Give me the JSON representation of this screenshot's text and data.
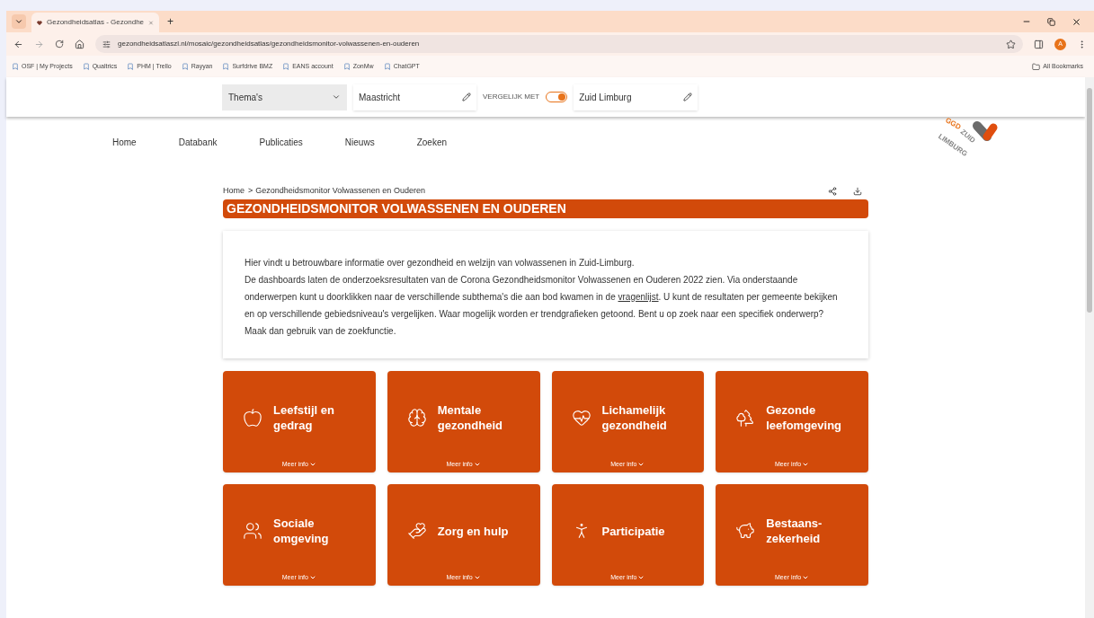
{
  "browser": {
    "tab": {
      "title": "Gezondheidsatlas - Gezondhe",
      "selected": true
    },
    "new_tab": "+",
    "url": "gezondheidsatlaszl.nl/mosaic/gezondheidsatlas/gezondheidsmonitor-volwassenen-en-ouderen",
    "profile_initial": "A",
    "bookmarks": [
      "OSF | My Projects",
      "Qualtrics",
      "PHM | Trello",
      "Rayyan",
      "Surfdrive BMZ",
      "EANS account",
      "ZonMw",
      "ChatGPT"
    ],
    "all_bookmarks": "All Bookmarks"
  },
  "filter_bar": {
    "theme_select": "Thema's",
    "region": "Maastricht",
    "compare_label": "VERGELIJK MET",
    "compare_on": true,
    "compare_region": "Zuid Limburg"
  },
  "nav": [
    {
      "label": "Home"
    },
    {
      "label": "Databank"
    },
    {
      "label": "Publicaties"
    },
    {
      "label": "Nieuws"
    },
    {
      "label": "Zoeken"
    }
  ],
  "logo": {
    "top": "GGD",
    "middle": "ZUID",
    "bottom": "LIMBURG"
  },
  "breadcrumb": [
    "Home",
    "Gezondheidsmonitor Volwassenen en Ouderen"
  ],
  "breadcrumb_separator": ">",
  "page_title": "GEZONDHEIDSMONITOR VOLWASSENEN EN OUDEREN",
  "intro": {
    "line_1": "Hier vindt u betrouwbare informatie over gezondheid en welzijn van volwassenen in Zuid-Limburg.",
    "before_link": "De dashboards laten de onderzoeksresultaten van de Corona Gezondheidsmonitor Volwassenen en Ouderen 2022 zien. Via onderstaande onderwerpen kunt u doorklikken naar de verschillende subthema's die aan bod kwamen in de",
    "link": "vragenlijst",
    "after_link": ". U kunt de resultaten per gemeente bekijken en op verschillende gebiedsniveau's vergelijken. Waar mogelijk worden er trendgrafieken getoond. Bent u op zoek naar een specifiek onderwerp? Maak dan gebruik van de zoekfunctie."
  },
  "tiles": [
    {
      "title": "Leefstijl en gedrag",
      "more": "Meer info"
    },
    {
      "title": "Mentale gezondheid",
      "more": "Meer info"
    },
    {
      "title": "Lichamelijk gezondheid",
      "more": "Meer info"
    },
    {
      "title": "Gezonde leefomgeving",
      "more": "Meer info"
    },
    {
      "title": "Sociale omgeving",
      "more": "Meer info"
    },
    {
      "title": "Zorg en hulp",
      "more": "Meer info"
    },
    {
      "title": "Participatie",
      "more": "Meer info"
    },
    {
      "title": "Bestaans-zekerheid",
      "more": "Meer info"
    }
  ]
}
